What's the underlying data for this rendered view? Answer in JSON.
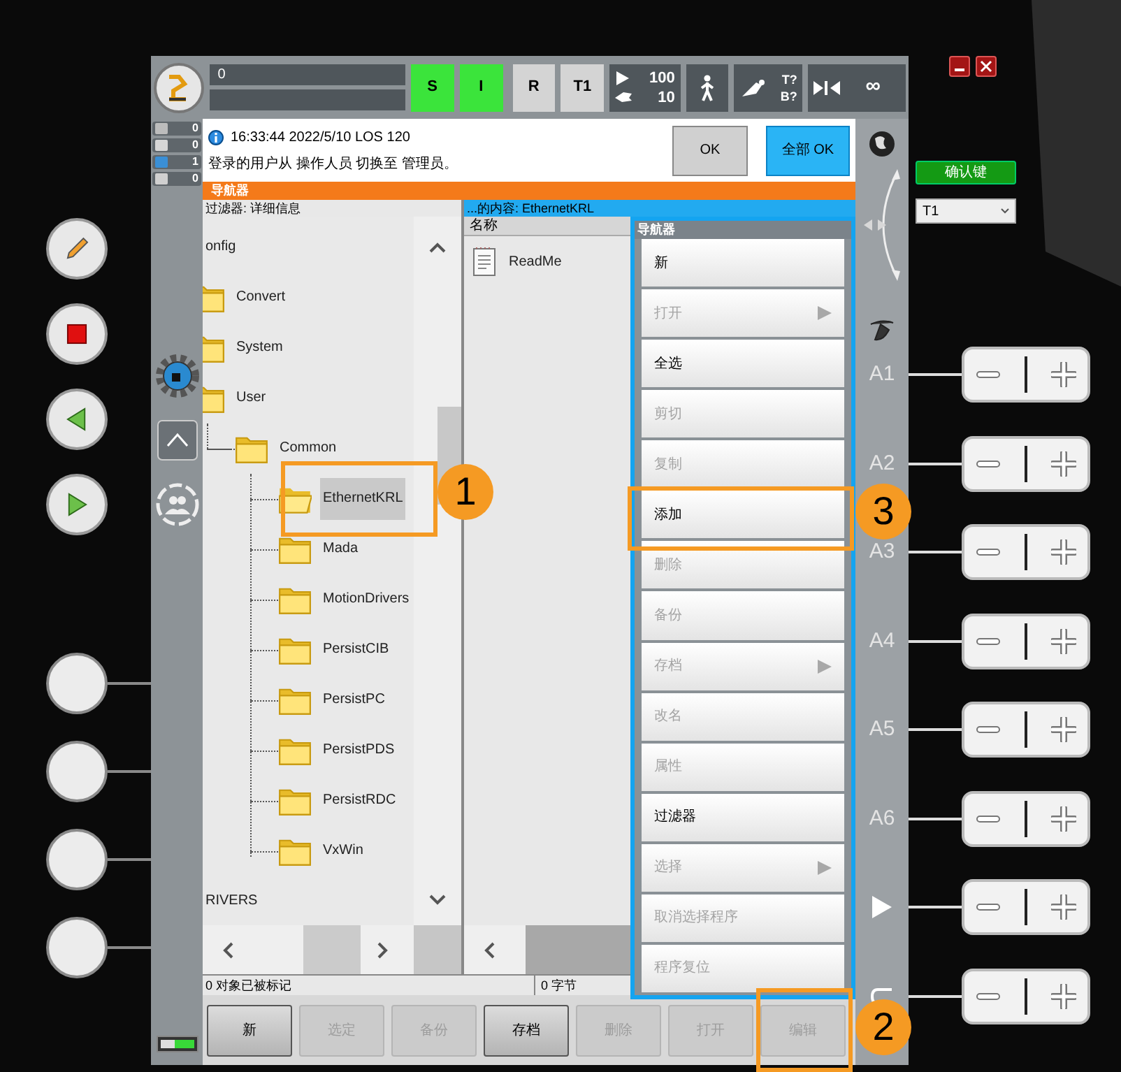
{
  "top_bar": {
    "program_field": "0",
    "status_buttons": [
      {
        "label": "S",
        "active": true
      },
      {
        "label": "I",
        "active": true
      },
      {
        "label": "R",
        "active": false
      },
      {
        "label": "T1",
        "active": false
      }
    ],
    "override": {
      "program": "100",
      "jog": "10"
    },
    "tool": {
      "tool": "T?",
      "base": "B?"
    },
    "run_mode": "∞"
  },
  "message_counters": [
    {
      "kind": "acknowledge",
      "count": "0"
    },
    {
      "kind": "state",
      "count": "0"
    },
    {
      "kind": "info",
      "count": "1"
    },
    {
      "kind": "dialog",
      "count": "0"
    }
  ],
  "message": {
    "header": "16:33:44 2022/5/10 LOS 120",
    "text": "登录的用户从 操作人员 切换至 管理员。",
    "buttons": [
      {
        "label": "OK",
        "kind": "normal"
      },
      {
        "label": "全部 OK",
        "kind": "primary"
      }
    ]
  },
  "navigator": {
    "title": "导航器",
    "filter": "过滤器: 详细信息",
    "content_title": "...的内容: EthernetKRL",
    "tree": [
      {
        "label": "onfig",
        "selected": false,
        "children": [
          {
            "label": "Convert",
            "selected": false
          },
          {
            "label": "System",
            "selected": false
          },
          {
            "label": "User",
            "selected": false,
            "children": [
              {
                "label": "Common",
                "selected": false,
                "children": [
                  {
                    "label": "EthernetKRL",
                    "selected": true
                  },
                  {
                    "label": "Mada",
                    "selected": false
                  },
                  {
                    "label": "MotionDrivers",
                    "selected": false
                  },
                  {
                    "label": "PersistCIB",
                    "selected": false
                  },
                  {
                    "label": "PersistPC",
                    "selected": false
                  },
                  {
                    "label": "PersistPDS",
                    "selected": false
                  },
                  {
                    "label": "PersistRDC",
                    "selected": false
                  },
                  {
                    "label": "VxWin",
                    "selected": false
                  }
                ]
              }
            ]
          }
        ]
      },
      {
        "label": "RIVERS",
        "selected": false
      }
    ],
    "columns": [
      "名称"
    ],
    "files": [
      "ReadMe"
    ],
    "status": [
      "0 对象已被标记",
      "0 字节"
    ]
  },
  "bottom_buttons": [
    {
      "label": "新",
      "disabled": false
    },
    {
      "label": "选定",
      "disabled": true
    },
    {
      "label": "备份",
      "disabled": true
    },
    {
      "label": "存档",
      "disabled": false
    },
    {
      "label": "删除",
      "disabled": true
    },
    {
      "label": "打开",
      "disabled": true
    },
    {
      "label": "编辑",
      "disabled": true
    }
  ],
  "context_menu": {
    "title": "导航器",
    "items": [
      {
        "label": "新",
        "disabled": false,
        "submenu": false
      },
      {
        "label": "打开",
        "disabled": true,
        "submenu": true
      },
      {
        "label": "全选",
        "disabled": false,
        "submenu": false
      },
      {
        "label": "剪切",
        "disabled": true,
        "submenu": false
      },
      {
        "label": "复制",
        "disabled": true,
        "submenu": false
      },
      {
        "label": "添加",
        "disabled": false,
        "submenu": false
      },
      {
        "label": "删除",
        "disabled": true,
        "submenu": false
      },
      {
        "label": "备份",
        "disabled": true,
        "submenu": false
      },
      {
        "label": "存档",
        "disabled": true,
        "submenu": true
      },
      {
        "label": "改名",
        "disabled": true,
        "submenu": false
      },
      {
        "label": "属性",
        "disabled": true,
        "submenu": false
      },
      {
        "label": "过滤器",
        "disabled": false,
        "submenu": false
      },
      {
        "label": "选择",
        "disabled": true,
        "submenu": true
      },
      {
        "label": "取消选择程序",
        "disabled": true,
        "submenu": false
      },
      {
        "label": "程序复位",
        "disabled": true,
        "submenu": false
      }
    ]
  },
  "side_panel": {
    "confirm_button": "确认键",
    "mode_select": "T1",
    "axes": [
      "A1",
      "A2",
      "A3",
      "A4",
      "A5",
      "A6"
    ]
  },
  "callouts": [
    "1",
    "2",
    "3"
  ]
}
